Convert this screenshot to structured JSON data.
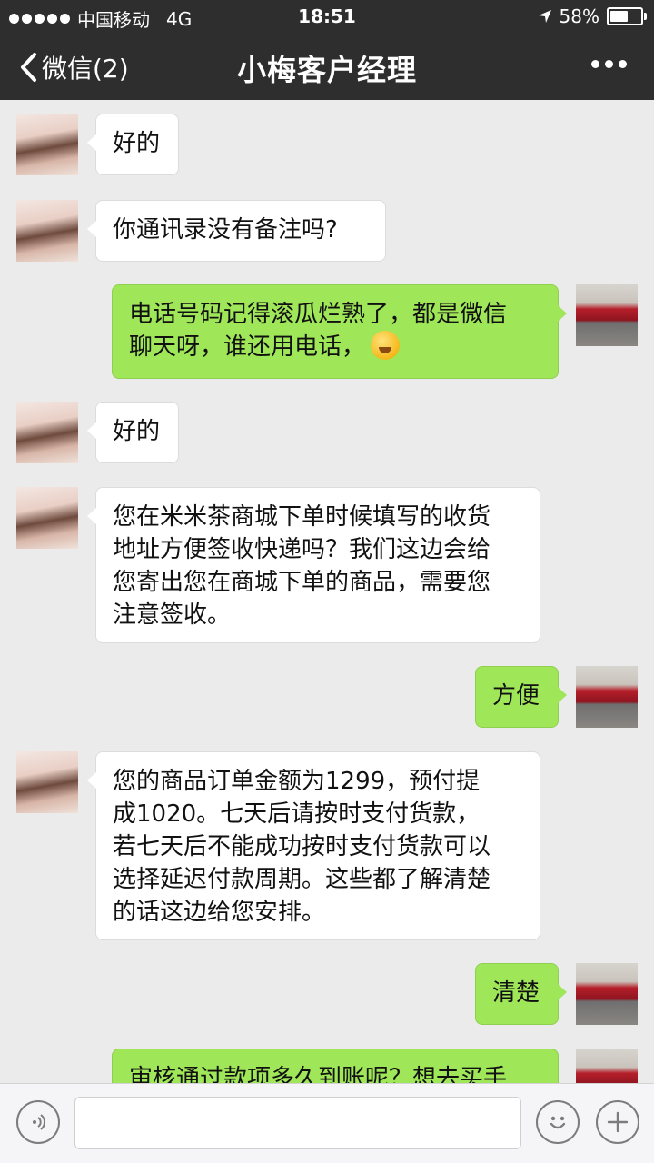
{
  "status_bar": {
    "carrier": "中国移动",
    "network": "4G",
    "time": "18:51",
    "battery": "58%",
    "battery_level": 0.58
  },
  "nav": {
    "back_label": "微信(2)",
    "title": "小梅客户经理"
  },
  "messages": [
    {
      "side": "left",
      "text": "好的"
    },
    {
      "side": "left",
      "text": "你通讯录没有备注吗?"
    },
    {
      "side": "right",
      "lines": [
        "电话号码记得滚瓜烂熟了，都是微信",
        "聊天呀，谁还用电话，"
      ],
      "emoji": "laughing-crying-emoji"
    },
    {
      "side": "left",
      "text": "好的"
    },
    {
      "side": "left",
      "lines": [
        "您在米米茶商城下单时候填写的收货",
        "地址方便签收快递吗？我们这边会给",
        "您寄出您在商城下单的商品，需要您",
        "注意签收。"
      ]
    },
    {
      "side": "right",
      "text": "方便"
    },
    {
      "side": "left",
      "lines": [
        "您的商品订单金额为1299，预付提",
        "成1020。七天后请按时支付货款，",
        "若七天后不能成功按时支付货款可以",
        "选择延迟付款周期。这些都了解清楚",
        "的话这边给您安排。"
      ]
    },
    {
      "side": "right",
      "text": "清楚"
    },
    {
      "side": "right",
      "text": "审核通过款项多久到账呢？想去买手"
    }
  ],
  "input_bar": {
    "placeholder": ""
  }
}
